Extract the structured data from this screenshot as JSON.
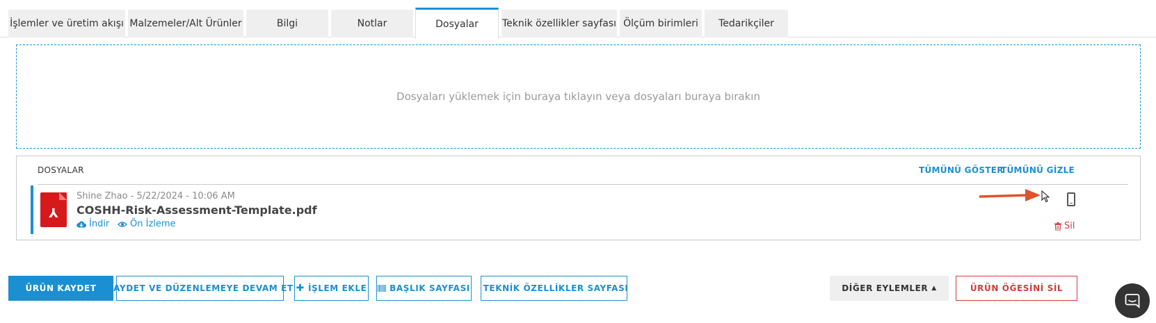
{
  "tabs": [
    {
      "label": "İşlemler ve üretim akışı"
    },
    {
      "label": "Malzemeler/Alt Ürünler"
    },
    {
      "label": "Bilgi"
    },
    {
      "label": "Notlar"
    },
    {
      "label": "Dosyalar",
      "active": true
    },
    {
      "label": "Teknik özellikler sayfası"
    },
    {
      "label": "Ölçüm birimleri"
    },
    {
      "label": "Tedarikçiler"
    }
  ],
  "dropzone": {
    "text": "Dosyaları yüklemek için buraya tıklayın veya dosyaları buraya bırakın"
  },
  "files_panel": {
    "title": "DOSYALAR",
    "show_all": "TÜMÜNÜ GÖSTER",
    "hide_all": "TÜMÜNÜ GİZLE",
    "file": {
      "meta": "Shine Zhao - 5/22/2024 - 10:06 AM",
      "name": "COSHH-Risk-Assessment-Template.pdf",
      "download_label": "İndir",
      "preview_label": "Ön İzleme",
      "delete_label": "Sil",
      "icon": "pdf-file-icon"
    }
  },
  "buttons": {
    "save_product": "ÜRÜN KAYDET",
    "save_continue": "KAYDET VE DÜZENLEMEYE DEVAM ET",
    "add_operation": "İŞLEM EKLE",
    "title_page": "BAŞLIK SAYFASI",
    "tech_spec_page": "TEKNİK ÖZELLİKLER SAYFASI",
    "other_actions": "DİĞER EYLEMLER",
    "delete_product": "ÜRÜN ÖĞESİNİ SİL"
  },
  "colors": {
    "accent": "#1a8fd1",
    "danger": "#d43b3b",
    "pdf": "#d6191b",
    "annotation_arrow": "#e0522a"
  }
}
